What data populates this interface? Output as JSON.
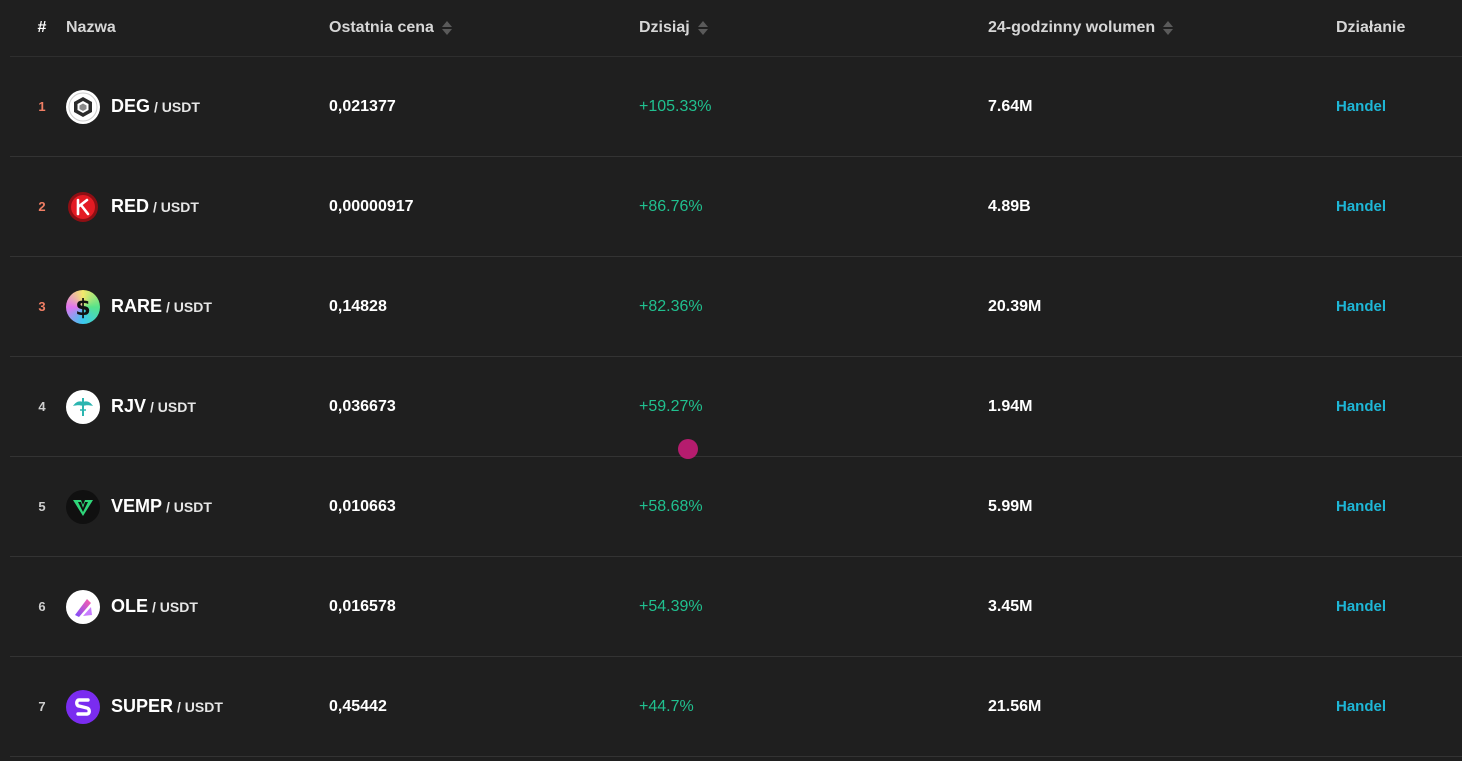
{
  "header": {
    "rank": "#",
    "name": "Nazwa",
    "price": "Ostatnia cena",
    "today": "Dzisiaj",
    "volume": "24-godzinny wolumen",
    "action": "Działanie"
  },
  "colors": {
    "background": "#1f1f1f",
    "positive": "#20c08f",
    "link": "#1eb6d6",
    "rank_hot": "#f07e64"
  },
  "rows": [
    {
      "rank": "1",
      "symbol": "DEG",
      "quote": "/ USDT",
      "price": "0,021377",
      "change": "+105.33%",
      "volume": "7.64M",
      "action": "Handel",
      "icon": "deg-logo-icon"
    },
    {
      "rank": "2",
      "symbol": "RED",
      "quote": "/ USDT",
      "price": "0,00000917",
      "change": "+86.76%",
      "volume": "4.89B",
      "action": "Handel",
      "icon": "red-logo-icon"
    },
    {
      "rank": "3",
      "symbol": "RARE",
      "quote": "/ USDT",
      "price": "0,14828",
      "change": "+82.36%",
      "volume": "20.39M",
      "action": "Handel",
      "icon": "rare-logo-icon"
    },
    {
      "rank": "4",
      "symbol": "RJV",
      "quote": "/ USDT",
      "price": "0,036673",
      "change": "+59.27%",
      "volume": "1.94M",
      "action": "Handel",
      "icon": "rjv-logo-icon"
    },
    {
      "rank": "5",
      "symbol": "VEMP",
      "quote": "/ USDT",
      "price": "0,010663",
      "change": "+58.68%",
      "volume": "5.99M",
      "action": "Handel",
      "icon": "vemp-logo-icon"
    },
    {
      "rank": "6",
      "symbol": "OLE",
      "quote": "/ USDT",
      "price": "0,016578",
      "change": "+54.39%",
      "volume": "3.45M",
      "action": "Handel",
      "icon": "ole-logo-icon"
    },
    {
      "rank": "7",
      "symbol": "SUPER",
      "quote": "/ USDT",
      "price": "0,45442",
      "change": "+44.7%",
      "volume": "21.56M",
      "action": "Handel",
      "icon": "super-logo-icon"
    }
  ]
}
